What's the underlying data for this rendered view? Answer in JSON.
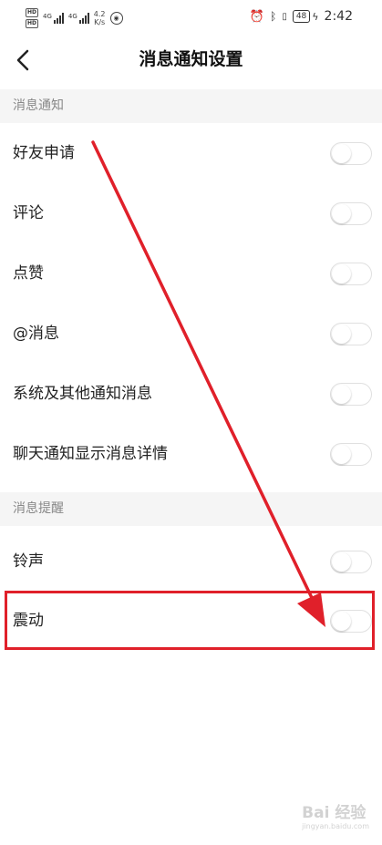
{
  "status_bar": {
    "network_speed": "4.2",
    "network_unit": "K/s",
    "signal1_label": "4G",
    "signal2_label": "4G",
    "battery": "48",
    "time": "2:42"
  },
  "header": {
    "title": "消息通知设置"
  },
  "sections": [
    {
      "title": "消息通知",
      "items": [
        {
          "label": "好友申请",
          "enabled": false
        },
        {
          "label": "评论",
          "enabled": false
        },
        {
          "label": "点赞",
          "enabled": false
        },
        {
          "label": "@消息",
          "enabled": false
        },
        {
          "label": "系统及其他通知消息",
          "enabled": false
        },
        {
          "label": "聊天通知显示消息详情",
          "enabled": false
        }
      ]
    },
    {
      "title": "消息提醒",
      "items": [
        {
          "label": "铃声",
          "enabled": false
        },
        {
          "label": "震动",
          "enabled": false
        }
      ]
    }
  ],
  "annotation": {
    "arrow_color": "#e0202a",
    "highlight_color": "#e0202a"
  },
  "watermark": {
    "main": "Bai 经验",
    "sub": "jingyan.baidu.com"
  }
}
